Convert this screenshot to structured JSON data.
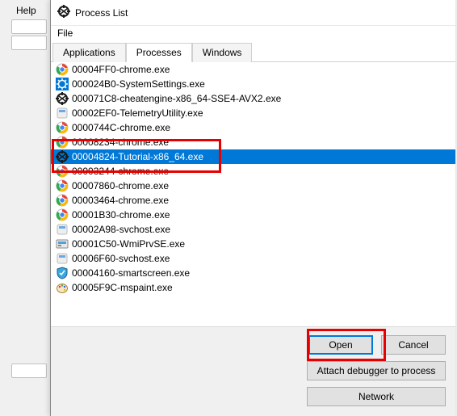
{
  "background": {
    "help_label": "Help"
  },
  "dialog": {
    "title": "Process List",
    "menu_file": "File",
    "tabs": {
      "applications": "Applications",
      "processes": "Processes",
      "windows": "Windows"
    },
    "selected_index": 6,
    "processes": [
      {
        "icon": "chrome",
        "text": "00004FF0-chrome.exe"
      },
      {
        "icon": "settings",
        "text": "000024B0-SystemSettings.exe"
      },
      {
        "icon": "ce",
        "text": "000071C8-cheatengine-x86_64-SSE4-AVX2.exe"
      },
      {
        "icon": "generic",
        "text": "00002EF0-TelemetryUtility.exe"
      },
      {
        "icon": "chrome",
        "text": "0000744C-chrome.exe"
      },
      {
        "icon": "chrome",
        "text": "00008234-chrome.exe"
      },
      {
        "icon": "ce",
        "text": "00004824-Tutorial-x86_64.exe"
      },
      {
        "icon": "chrome",
        "text": "00003244-chrome.exe"
      },
      {
        "icon": "chrome",
        "text": "00007860-chrome.exe"
      },
      {
        "icon": "chrome",
        "text": "00003464-chrome.exe"
      },
      {
        "icon": "chrome",
        "text": "00001B30-chrome.exe"
      },
      {
        "icon": "generic",
        "text": "00002A98-svchost.exe"
      },
      {
        "icon": "wmi",
        "text": "00001C50-WmiPrvSE.exe"
      },
      {
        "icon": "generic",
        "text": "00006F60-svchost.exe"
      },
      {
        "icon": "shield",
        "text": "00004160-smartscreen.exe"
      },
      {
        "icon": "paint",
        "text": "00005F9C-mspaint.exe"
      }
    ],
    "buttons": {
      "open": "Open",
      "cancel": "Cancel",
      "attach": "Attach debugger to process",
      "network": "Network"
    }
  }
}
